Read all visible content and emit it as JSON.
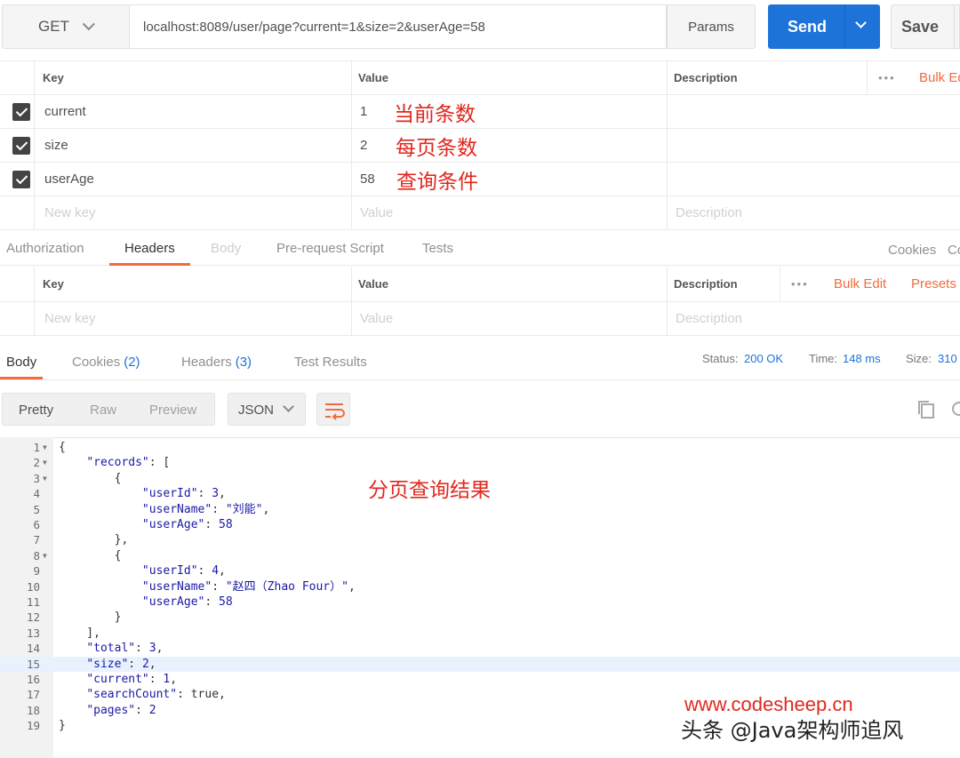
{
  "request": {
    "method": "GET",
    "url": "localhost:8089/user/page?current=1&size=2&userAge=58",
    "params_label": "Params",
    "send_label": "Send",
    "save_label": "Save"
  },
  "params_table": {
    "headers": {
      "key": "Key",
      "value": "Value",
      "description": "Description",
      "bulk_edit": "Bulk Ed"
    },
    "rows": [
      {
        "key": "current",
        "value": "1",
        "note": "当前条数"
      },
      {
        "key": "size",
        "value": "2",
        "note": "每页条数"
      },
      {
        "key": "userAge",
        "value": "58",
        "note": "查询条件"
      }
    ],
    "placeholder": {
      "key": "New key",
      "value": "Value",
      "description": "Description"
    }
  },
  "request_tabs": {
    "items": [
      "Authorization",
      "Headers",
      "Body",
      "Pre-request Script",
      "Tests"
    ],
    "active": "Headers",
    "cookies": "Cookies",
    "code": "Co"
  },
  "headers_table": {
    "headers": {
      "key": "Key",
      "value": "Value",
      "description": "Description",
      "bulk_edit": "Bulk Edit",
      "presets": "Presets"
    },
    "placeholder": {
      "key": "New key",
      "value": "Value",
      "description": "Description"
    }
  },
  "response_tabs": {
    "body": "Body",
    "cookies": "Cookies",
    "cookies_count": "(2)",
    "headers": "Headers",
    "headers_count": "(3)",
    "test_results": "Test Results",
    "status_label": "Status:",
    "status_value": "200 OK",
    "time_label": "Time:",
    "time_value": "148 ms",
    "size_label": "Size:",
    "size_value": "310"
  },
  "response_toolbar": {
    "views": [
      "Pretty",
      "Raw",
      "Preview"
    ],
    "active_view": "Pretty",
    "format": "JSON"
  },
  "code_lines": [
    "{",
    "    \"records\": [",
    "        {",
    "            \"userId\": 3,",
    "            \"userName\": \"刘能\",",
    "            \"userAge\": 58",
    "        },",
    "        {",
    "            \"userId\": 4,",
    "            \"userName\": \"赵四（Zhao Four）\",",
    "            \"userAge\": 58",
    "        }",
    "    ],",
    "    \"total\": 3,",
    "    \"size\": 2,",
    "    \"current\": 1,",
    "    \"searchCount\": true,",
    "    \"pages\": 2",
    "}"
  ],
  "highlighted_line": 15,
  "result_note": "分页查询结果",
  "watermark": {
    "site": "www.codesheep.cn",
    "author": "头条 @Java架构师追风"
  },
  "colors": {
    "accent": "#f26b3a",
    "send": "#1e73d8",
    "annotation": "#e0281e"
  }
}
